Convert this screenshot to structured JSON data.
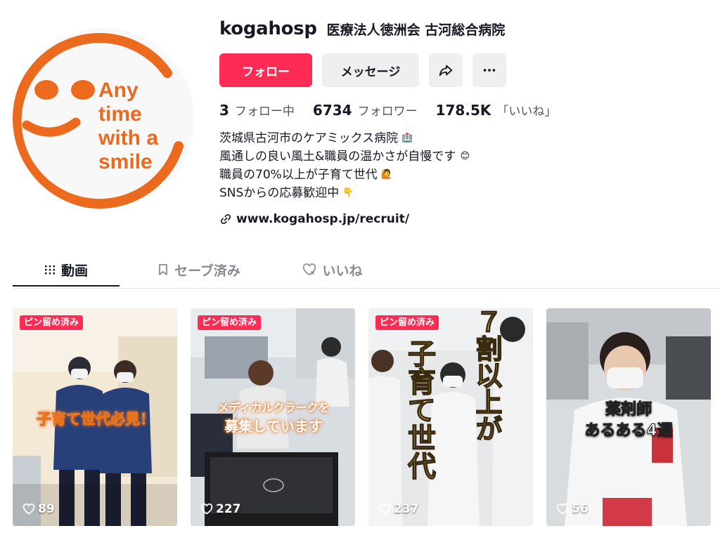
{
  "profile": {
    "username": "kogahosp",
    "nickname": "医療法人徳洲会 古河総合病院",
    "avatar_text": [
      "Any",
      "time",
      "with a",
      "smile"
    ]
  },
  "actions": {
    "follow_label": "フォロー",
    "message_label": "メッセージ",
    "share_icon": "share-icon",
    "more_icon": "more-icon"
  },
  "stats": {
    "following": {
      "value": "3",
      "label": "フォロー中"
    },
    "followers": {
      "value": "6734",
      "label": "フォロワー"
    },
    "likes": {
      "value": "178.5K",
      "label": "「いいね」"
    }
  },
  "bio": [
    {
      "text": "茨城県古河市のケアミックス病院",
      "emoji": "🏥"
    },
    {
      "text": "風通しの良い風土&職員の温かさが自慢です",
      "emoji": "😊"
    },
    {
      "text": "職員の70%以上が子育て世代",
      "emoji": "🙋"
    },
    {
      "text": "SNSからの応募歓迎中",
      "emoji": "👇"
    }
  ],
  "link": "www.kogahosp.jp/recruit/",
  "tabs": [
    {
      "label": "動画",
      "icon": "grid-icon",
      "active": true
    },
    {
      "label": "セーブ済み",
      "icon": "bookmark-icon",
      "active": false
    },
    {
      "label": "いいね",
      "icon": "heart-icon",
      "active": false
    }
  ],
  "videos": [
    {
      "pinned": true,
      "pin_label": "ピン留め済み",
      "overlay": "子育て世代必見！",
      "likes": "89"
    },
    {
      "pinned": true,
      "pin_label": "ピン留め済み",
      "overlay_line1": "メディカルクラークを",
      "overlay_line2": "募集しています",
      "likes": "227"
    },
    {
      "pinned": true,
      "pin_label": "ピン留め済み",
      "overlay_col1": "７割以上が",
      "overlay_col2": "子育て世代",
      "likes": "237"
    },
    {
      "pinned": false,
      "overlay_line1": "薬剤師",
      "overlay_line2": "あるある4選",
      "likes": "56"
    }
  ],
  "colors": {
    "accent": "#fe2c55",
    "avatar_orange": "#ec6a1e",
    "text": "#161823"
  }
}
